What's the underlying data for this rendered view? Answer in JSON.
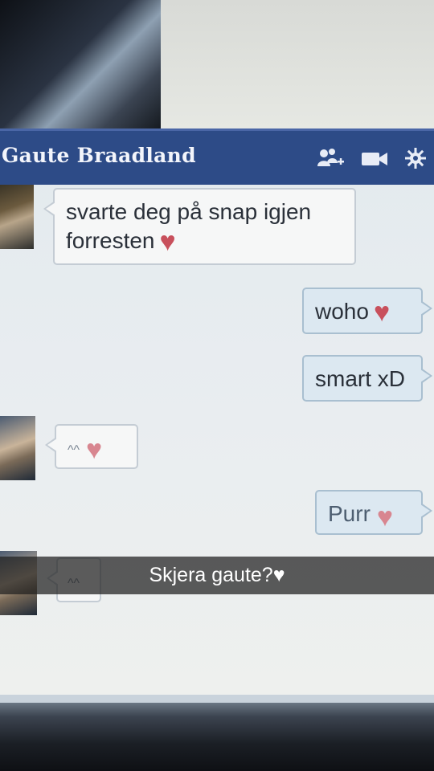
{
  "chat": {
    "title": "Gaute Braadland",
    "icons": [
      "add-friend-icon",
      "video-call-icon",
      "settings-gear-icon"
    ]
  },
  "messages": [
    {
      "from": "contact",
      "text": "svarte deg på snap igjen forresten",
      "emoji": "♥"
    },
    {
      "from": "me",
      "text": "woho",
      "emoji": "♥"
    },
    {
      "from": "me",
      "text": "smart xD",
      "emoji": ""
    },
    {
      "from": "contact",
      "text": "^^",
      "emoji": "♥"
    },
    {
      "from": "me",
      "text": "Purr",
      "emoji": "♥"
    },
    {
      "from": "contact",
      "text": "^^",
      "emoji": ""
    }
  ],
  "overlay": {
    "caption": "Skjera gaute?♥"
  },
  "colors": {
    "titlebar": "#2d4b87",
    "incoming_bubble": "#f6f7f7",
    "outgoing_bubble": "#dce8f1",
    "heart": "#c8505c"
  }
}
